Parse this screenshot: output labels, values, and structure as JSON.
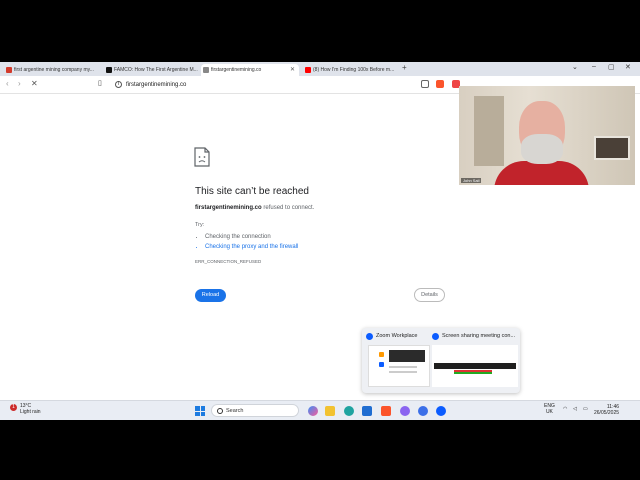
{
  "browser": {
    "tabs": [
      {
        "label": "first argentine mining company my...",
        "fav_color": "#d33b2c"
      },
      {
        "label": "FAMCO: How The First Argentine M...",
        "fav_color": "#111111"
      },
      {
        "label": "firstargentinemining.co",
        "fav_color": "#888888"
      },
      {
        "label": "(8) How I'm Finding 100x Before m...",
        "fav_color": "#ff0000"
      }
    ],
    "address": "firstargentinemining.co"
  },
  "error_page": {
    "title": "This site can’t be reached",
    "host": "firstargentinemining.co",
    "message": " refused to connect.",
    "try_label": "Try:",
    "suggestions": [
      "Checking the connection",
      "Checking the proxy and the firewall"
    ],
    "code": "ERR_CONNECTION_REFUSED",
    "reload_label": "Reload",
    "details_label": "Details"
  },
  "webcam": {
    "name": "John Sail"
  },
  "preview": {
    "items": [
      "Zoom Workplace",
      "Screen sharing meeting con..."
    ]
  },
  "taskbar": {
    "weather_temp": "13°C",
    "weather_desc": "Light rain",
    "weather_badge": "1",
    "search_label": "Search",
    "lang_1": "ENG",
    "lang_2": "UK",
    "time": "11:46",
    "date": "26/05/2025"
  }
}
